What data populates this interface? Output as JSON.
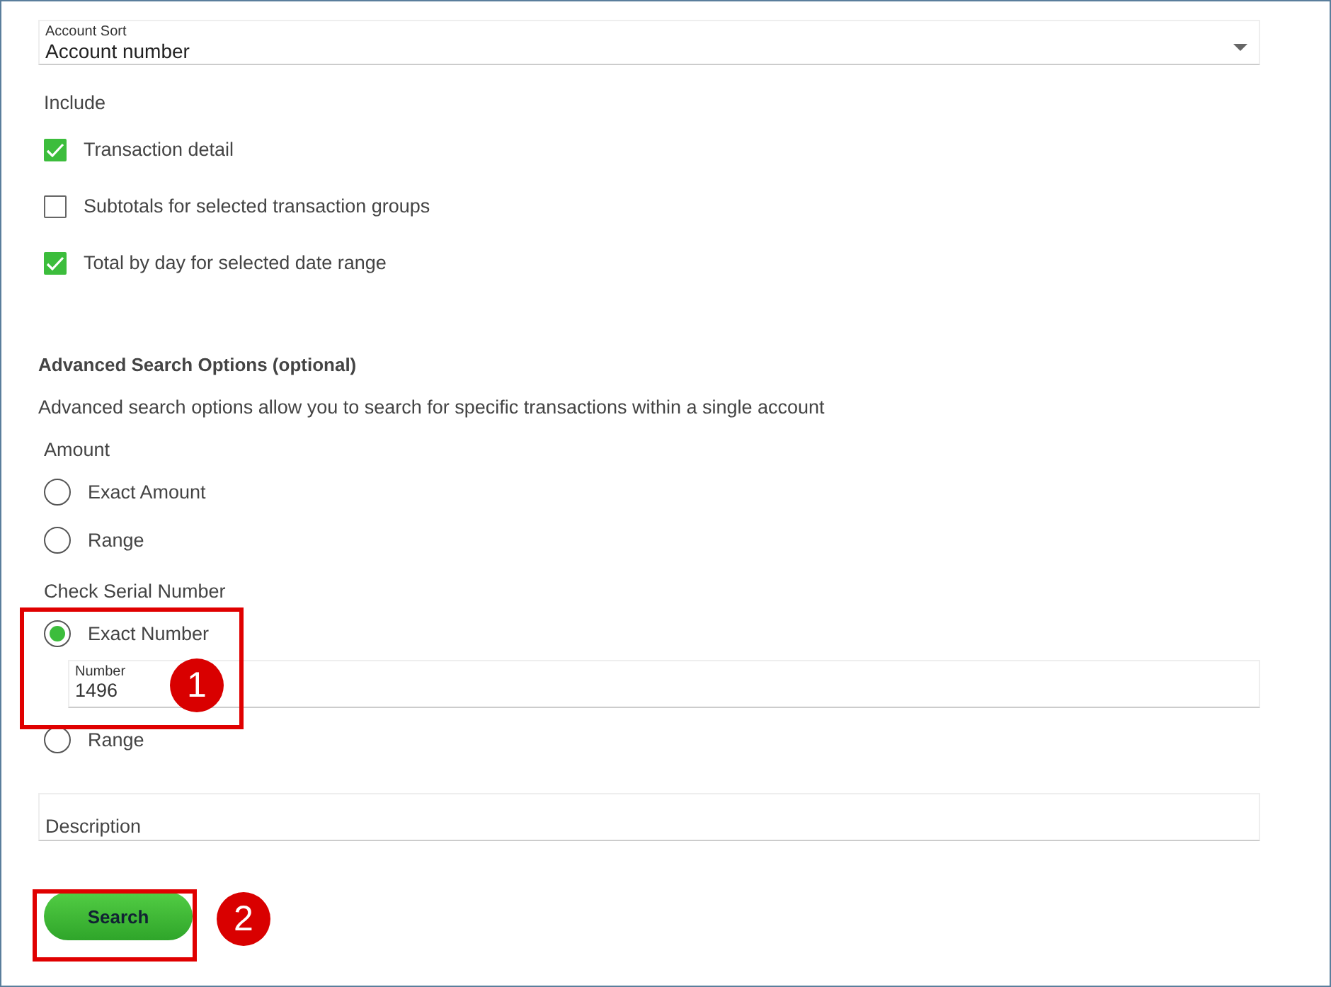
{
  "account_sort": {
    "label": "Account Sort",
    "value": "Account number"
  },
  "include": {
    "label": "Include",
    "options": [
      {
        "label": "Transaction detail",
        "checked": true
      },
      {
        "label": "Subtotals for selected transaction groups",
        "checked": false
      },
      {
        "label": "Total by day for selected date range",
        "checked": true
      }
    ]
  },
  "advanced": {
    "title": "Advanced Search Options (optional)",
    "description": "Advanced search options allow you to search for specific transactions within a single account"
  },
  "amount": {
    "label": "Amount",
    "options": [
      {
        "label": "Exact Amount",
        "selected": false
      },
      {
        "label": "Range",
        "selected": false
      }
    ]
  },
  "check_serial": {
    "label": "Check Serial Number",
    "options": [
      {
        "label": "Exact Number",
        "selected": true,
        "field": {
          "label": "Number",
          "value": "1496"
        }
      },
      {
        "label": "Range",
        "selected": false
      }
    ]
  },
  "description_field": {
    "placeholder": "Description"
  },
  "search_button": "Search",
  "callouts": [
    "1",
    "2"
  ]
}
